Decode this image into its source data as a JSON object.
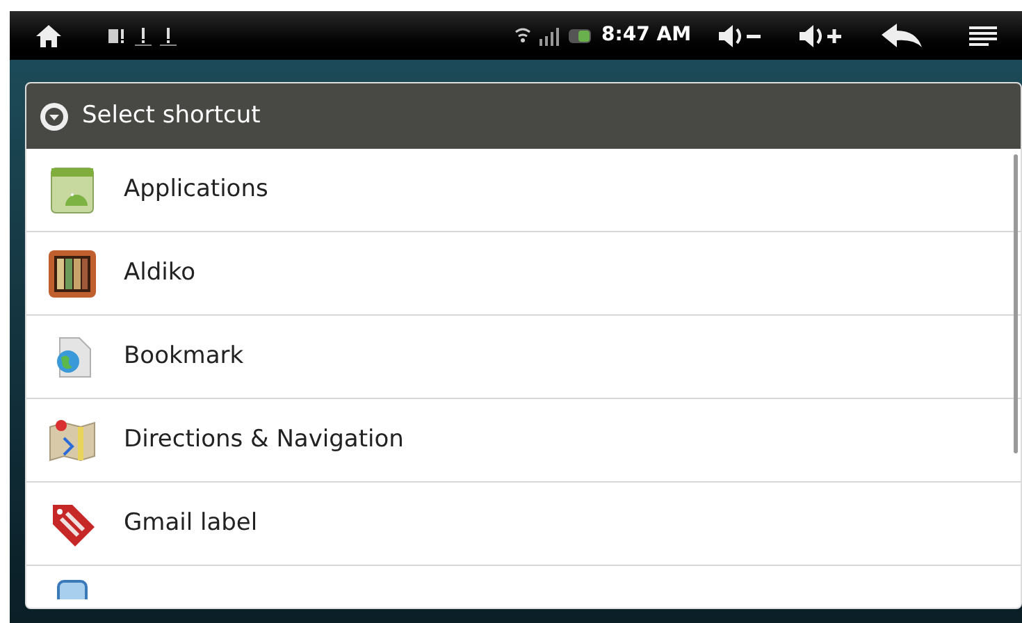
{
  "status_bar": {
    "time": "8:47 AM"
  },
  "dialog": {
    "title": "Select shortcut",
    "items": [
      {
        "label": "Applications",
        "kind": "applications"
      },
      {
        "label": "Aldiko",
        "kind": "books"
      },
      {
        "label": "Bookmark",
        "kind": "bookmark"
      },
      {
        "label": "Directions & Navigation",
        "kind": "map"
      },
      {
        "label": "Gmail label",
        "kind": "tag"
      },
      {
        "kind": "partial"
      }
    ]
  }
}
